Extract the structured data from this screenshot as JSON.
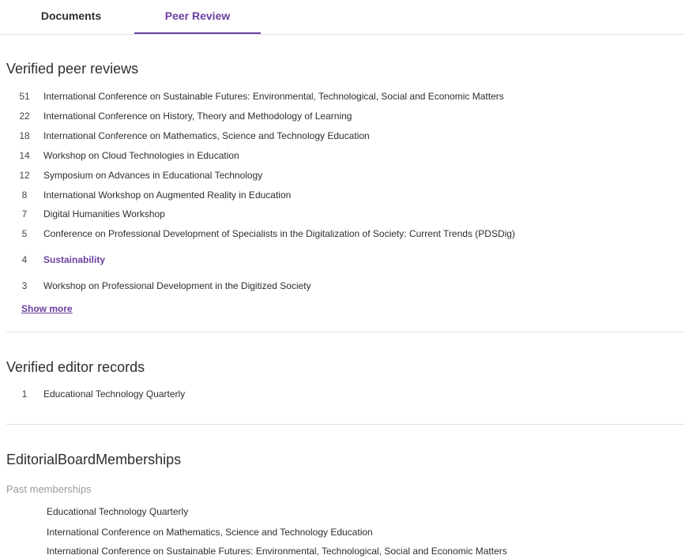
{
  "tabs": {
    "documents": "Documents",
    "peer_review": "Peer Review"
  },
  "peer_reviews": {
    "heading": "Verified peer reviews",
    "items": [
      {
        "count": "51",
        "title": "International Conference on Sustainable Futures: Environmental, Technological, Social and Economic Matters"
      },
      {
        "count": "22",
        "title": "International Conference on History, Theory and Methodology of Learning"
      },
      {
        "count": "18",
        "title": "International Conference on Mathematics, Science and Technology Education"
      },
      {
        "count": "14",
        "title": "Workshop on Cloud Technologies in Education"
      },
      {
        "count": "12",
        "title": "Symposium on Advances in Educational Technology"
      },
      {
        "count": "8",
        "title": "International Workshop on Augmented Reality in Education"
      },
      {
        "count": "7",
        "title": "Digital Humanities Workshop"
      },
      {
        "count": "5",
        "title": "Conference on Professional Development of Specialists in the Digitalization of Society: Current Trends (PDSDig)"
      },
      {
        "count": "4",
        "title": "Sustainability"
      },
      {
        "count": "3",
        "title": "Workshop on Professional Development in the Digitized Society"
      }
    ],
    "show_more": "Show more"
  },
  "editor_records": {
    "heading": "Verified editor records",
    "items": [
      {
        "count": "1",
        "title": "Educational Technology Quarterly"
      }
    ]
  },
  "editorial_board": {
    "heading": "EditorialBoardMemberships",
    "subheading": "Past memberships",
    "items": [
      "Educational Technology Quarterly",
      "International Conference on Mathematics, Science and Technology Education",
      "International Conference on Sustainable Futures: Environmental, Technological, Social and Economic Matters"
    ]
  },
  "colors": {
    "accent": "#6b3fa0",
    "text": "#2e2e2e",
    "muted": "#9a9a9a",
    "divider": "#e4e4e4"
  }
}
